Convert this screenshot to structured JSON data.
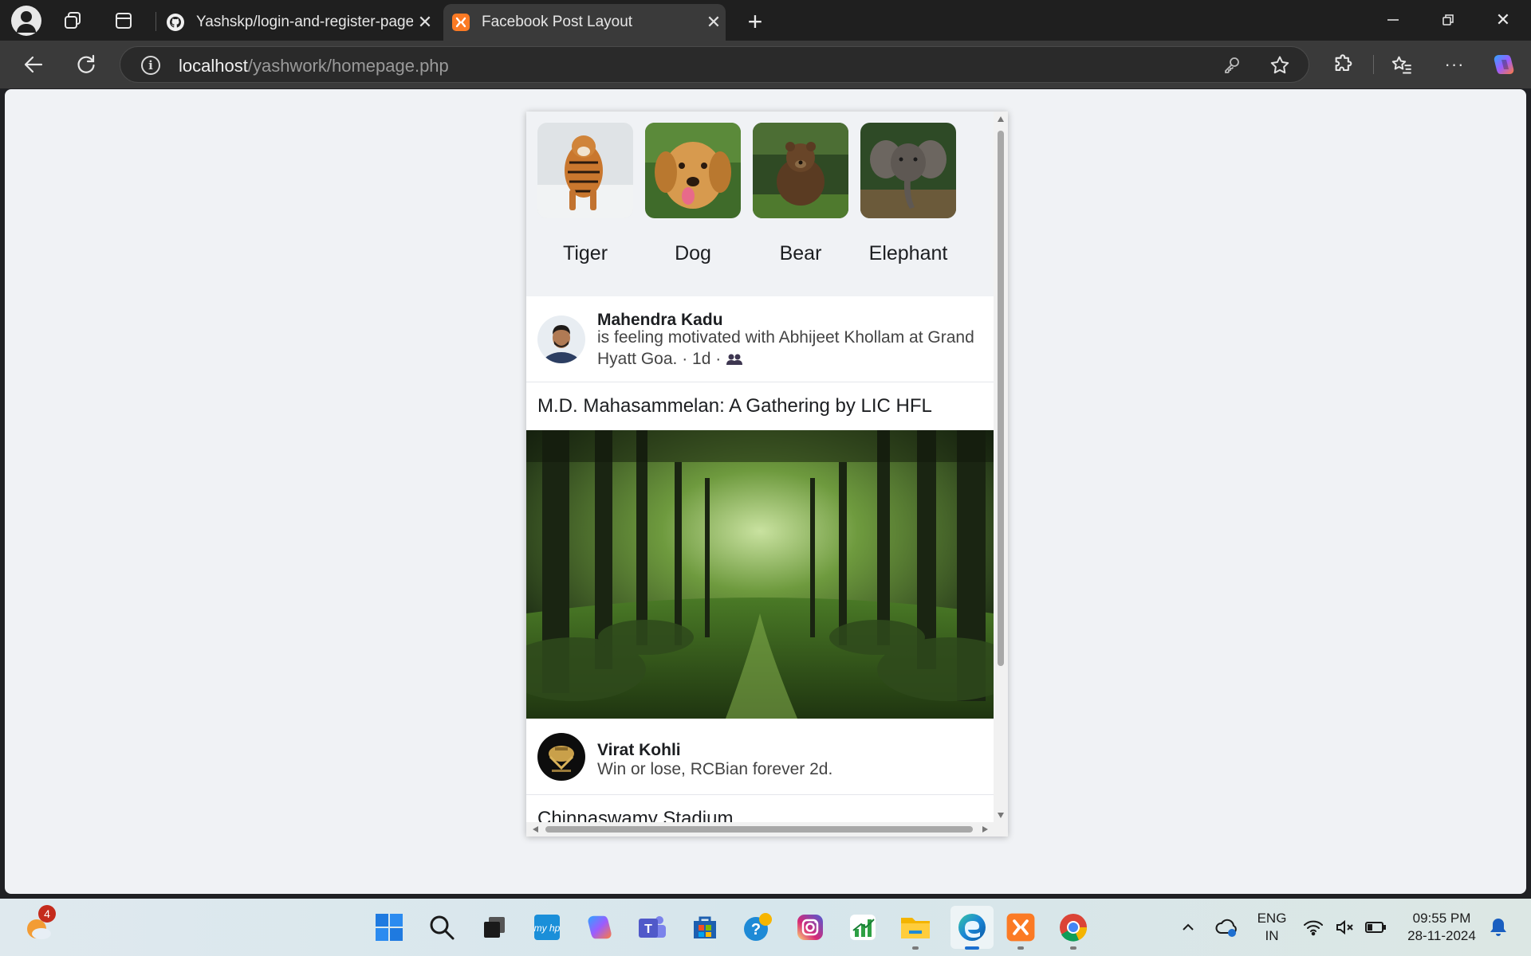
{
  "browser": {
    "tabs": [
      {
        "title": "Yashskp/login-and-register-page",
        "active": false,
        "icon": "github-icon"
      },
      {
        "title": "Facebook Post Layout",
        "active": true,
        "icon": "xampp-icon"
      }
    ],
    "url_host": "localhost",
    "url_path": "/yashwork/homepage.php"
  },
  "stories": [
    {
      "label": "Tiger"
    },
    {
      "label": "Dog"
    },
    {
      "label": "Bear"
    },
    {
      "label": "Elephant"
    }
  ],
  "posts": [
    {
      "author": "Mahendra Kadu",
      "desc_line1": "is feeling motivated with Abhijeet Khollam at Grand",
      "desc_line2": "Hyatt Goa. · 1d · ",
      "title": "M.D. Mahasammelan: A Gathering by LIC HFL"
    },
    {
      "author": "Virat Kohli",
      "desc_line1": "Win or lose, RCBian forever 2d.",
      "title": "Chinnaswamy Stadium"
    }
  ],
  "taskbar": {
    "weather_badge": "4",
    "lang_line1": "ENG",
    "lang_line2": "IN",
    "time": "09:55 PM",
    "date": "28-11-2024"
  }
}
